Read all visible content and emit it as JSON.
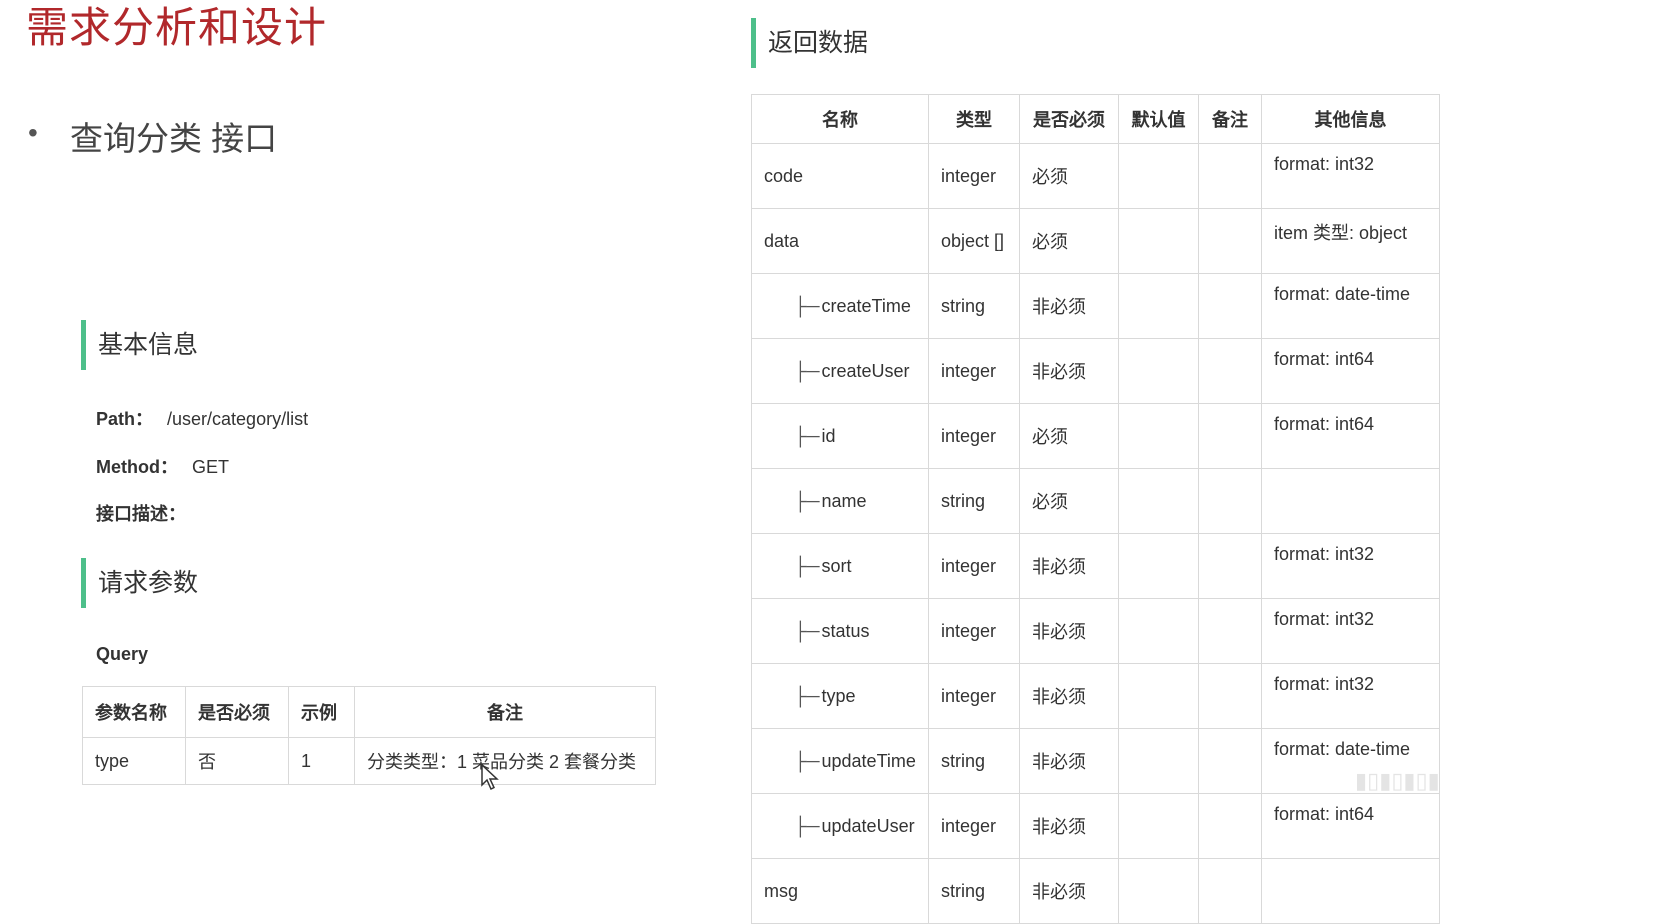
{
  "title": "需求分析和设计",
  "bullet": "查询分类 接口",
  "basic_info": {
    "heading": "基本信息",
    "path_label": "Path：",
    "path_value": "/user/category/list",
    "method_label": "Method：",
    "method_value": "GET",
    "desc_label": "接口描述："
  },
  "request": {
    "heading": "请求参数",
    "query_label": "Query",
    "headers": [
      "参数名称",
      "是否必须",
      "示例",
      "备注"
    ],
    "rows": [
      {
        "name": "type",
        "required": "否",
        "example": "1",
        "note": "分类类型：1 菜品分类 2 套餐分类"
      }
    ]
  },
  "response": {
    "heading": "返回数据",
    "headers": [
      "名称",
      "类型",
      "是否必须",
      "默认值",
      "备注",
      "其他信息"
    ],
    "rows": [
      {
        "name": "code",
        "type": "integer",
        "required": "必须",
        "default": "",
        "note": "",
        "other": "format: int32"
      },
      {
        "name": "data",
        "type": "object []",
        "required": "必须",
        "default": "",
        "note": "",
        "other": "item 类型: object"
      },
      {
        "name": "createTime",
        "type": "string",
        "required": "非必须",
        "default": "",
        "note": "",
        "other": "format: date-time"
      },
      {
        "name": "createUser",
        "type": "integer",
        "required": "非必须",
        "default": "",
        "note": "",
        "other": "format: int64"
      },
      {
        "name": "id",
        "type": "integer",
        "required": "必须",
        "default": "",
        "note": "",
        "other": "format: int64"
      },
      {
        "name": "name",
        "type": "string",
        "required": "必须",
        "default": "",
        "note": "",
        "other": ""
      },
      {
        "name": "sort",
        "type": "integer",
        "required": "非必须",
        "default": "",
        "note": "",
        "other": "format: int32"
      },
      {
        "name": "status",
        "type": "integer",
        "required": "非必须",
        "default": "",
        "note": "",
        "other": "format: int32"
      },
      {
        "name": "type",
        "type": "integer",
        "required": "非必须",
        "default": "",
        "note": "",
        "other": "format: int32"
      },
      {
        "name": "updateTime",
        "type": "string",
        "required": "非必须",
        "default": "",
        "note": "",
        "other": "format: date-time"
      },
      {
        "name": "updateUser",
        "type": "integer",
        "required": "非必须",
        "default": "",
        "note": "",
        "other": "format: int64"
      },
      {
        "name": "msg",
        "type": "string",
        "required": "非必须",
        "default": "",
        "note": "",
        "other": ""
      }
    ]
  },
  "tree_prefix": "├─",
  "accent_color": "#4dbf8a",
  "title_color": "#b1282b"
}
